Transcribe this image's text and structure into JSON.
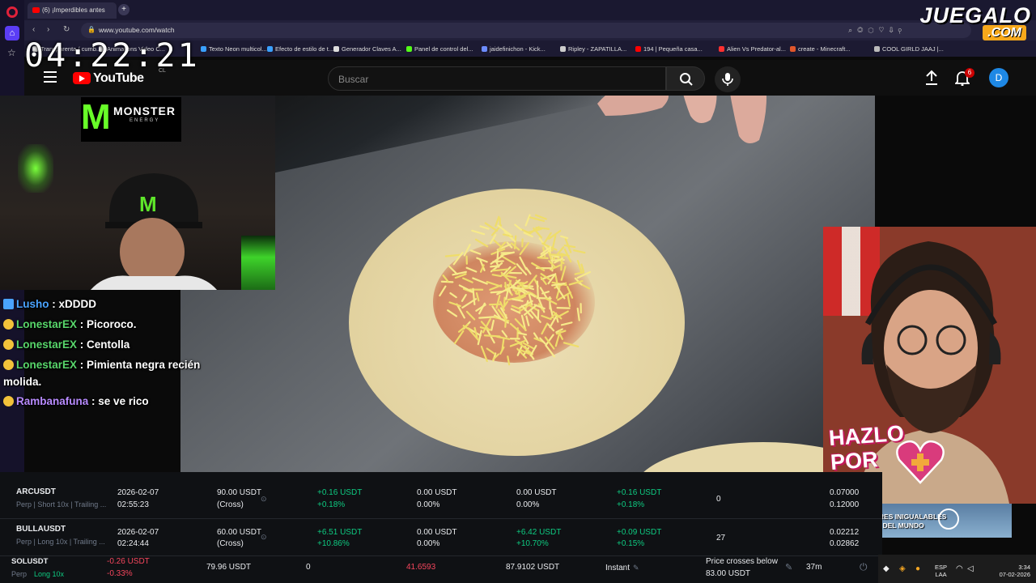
{
  "browser": {
    "tab_title": "(6) ¡Imperdibles antes",
    "url": "www.youtube.com/watch",
    "bookmarks": [
      "Transparenta / cumb...",
      "Animations Video C...",
      "Texto Neon multicol...",
      "Efecto de estilo de t...",
      "Generador Claves A...",
      "Panel de control del...",
      "jaidefinichon - Kick...",
      "Ripley - ZAPATILLA...",
      "194 | Pequeña casa...",
      "Alien Vs Predator-al...",
      "create - Minecraft...",
      "COOL GIRLD JAAJ |..."
    ],
    "bookmark_colors": [
      "#e8e8e8",
      "#e8e8e8",
      "#3aa0ff",
      "#3aa0ff",
      "#dddddd",
      "#53fc18",
      "#6c8cff",
      "#cccccc",
      "#ff0000",
      "#ff3030",
      "#e0562b",
      "#bbbbbb"
    ]
  },
  "overlay": {
    "clock": "04:22:21",
    "brand": "JUEGALO",
    "brand_suffix": ".COM",
    "monster_brand": "MONSTER",
    "monster_sub": "ENERGY",
    "hazlo_line1": "HAZLO",
    "hazlo_line2": "POR"
  },
  "youtube": {
    "logo_text": "YouTube",
    "country_code": "CL",
    "search_placeholder": "Buscar",
    "notifications": "6",
    "avatar_letter": "D"
  },
  "chat": [
    {
      "user": "Lusho",
      "message": ": xDDDD",
      "user_color": "#4aa3ff"
    },
    {
      "user": "LonestarEX",
      "message": ": Picoroco.",
      "user_color": "#58d66b"
    },
    {
      "user": "LonestarEX",
      "message": ": Centolla",
      "user_color": "#58d66b"
    },
    {
      "user": "LonestarEX",
      "message": ": Pimienta negra recién molida.",
      "user_color": "#58d66b"
    },
    {
      "user": "Rambanafuna",
      "message": ": se ve rico",
      "user_color": "#b88bff"
    }
  ],
  "thumbnail": {
    "line1": "ABORES INIGUALABLES",
    "line2": "L FIN DEL MUNDO"
  },
  "trading": {
    "rows": [
      {
        "symbol": "ARCUSDT",
        "meta": "Perp | Short 10x | Trailing ...",
        "date": "2026-02-07",
        "time": "02:55:23",
        "margin": "90.00 USDT",
        "margin_mode": "(Cross)",
        "pnl_a": "+0.16 USDT",
        "pnl_a_pct": "+0.18%",
        "pnl_b": "0.00 USDT",
        "pnl_b_pct": "0.00%",
        "pnl_c": "0.00 USDT",
        "pnl_c_pct": "0.00%",
        "pnl_d": "+0.16 USDT",
        "pnl_d_pct": "+0.18%",
        "count": "0",
        "price1": "0.07000",
        "price2": "0.12000"
      },
      {
        "symbol": "BULLAUSDT",
        "meta": "Perp | Long 10x | Trailing ...",
        "date": "2026-02-07",
        "time": "02:24:44",
        "margin": "60.00 USDT",
        "margin_mode": "(Cross)",
        "pnl_a": "+6.51 USDT",
        "pnl_a_pct": "+10.86%",
        "pnl_b": "0.00 USDT",
        "pnl_b_pct": "0.00%",
        "pnl_c": "+6.42 USDT",
        "pnl_c_pct": "+10.70%",
        "pnl_d": "+0.09 USDT",
        "pnl_d_pct": "+0.15%",
        "count": "27",
        "price1": "0.02212",
        "price2": "0.02862"
      }
    ],
    "sol": {
      "symbol": "SOLUSDT",
      "meta_perp": "Perp",
      "meta_long": "Long 10x",
      "pnl": "-0.26 USDT",
      "pnl_pct": "-0.33%",
      "value": "79.96 USDT",
      "zero": "0",
      "price": "41.6593",
      "total": "87.9102 USDT",
      "mode": "Instant",
      "trigger_line1": "Price crosses below",
      "trigger_line2": "83.00 USDT",
      "duration": "37m"
    }
  },
  "taskbar": {
    "lang1": "ESP",
    "lang2": "LAA",
    "time": "3:34",
    "date": "07-02-2026"
  }
}
